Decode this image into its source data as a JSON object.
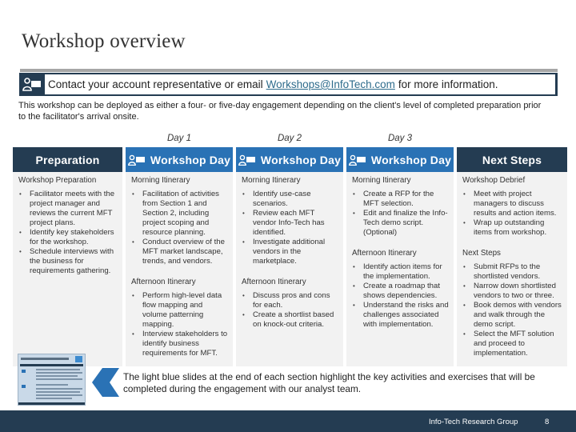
{
  "slide": {
    "title": "Workshop overview",
    "contact": {
      "prefix": "Contact your account representative or email",
      "email": "Workshops@InfoTech.com",
      "suffix": "for more information.",
      "icon": "person-board-icon"
    },
    "intro": "This workshop can be deployed as either a four- or five-day engagement depending on the client's level of completed preparation prior to the facilitator's arrival onsite.",
    "day_labels": [
      "Day 1",
      "Day 2",
      "Day 3"
    ],
    "columns": [
      {
        "header": "Preparation",
        "style": "dark",
        "sections": [
          {
            "title": "Workshop Preparation",
            "items": [
              "Facilitator meets with the project manager and reviews the current MFT project plans.",
              "Identify key stakeholders for the workshop.",
              "Schedule interviews with the business for requirements gathering."
            ]
          }
        ]
      },
      {
        "header": "Workshop Day",
        "style": "blue",
        "icon": "person-board-icon",
        "sections": [
          {
            "title": "Morning Itinerary",
            "items": [
              "Facilitation of activities from Section 1 and Section 2, including project scoping and resource planning.",
              "Conduct overview of the MFT market landscape, trends, and vendors."
            ]
          },
          {
            "title": "Afternoon Itinerary",
            "items": [
              "Perform high-level data flow mapping and volume patterning mapping.",
              "Interview stakeholders to identify business requirements for MFT."
            ]
          }
        ]
      },
      {
        "header": "Workshop Day",
        "style": "blue",
        "icon": "person-board-icon",
        "sections": [
          {
            "title": "Morning Itinerary",
            "items": [
              "Identify use-case scenarios.",
              "Review each MFT vendor Info-Tech has identified.",
              "Investigate additional vendors in the marketplace."
            ]
          },
          {
            "title": "Afternoon Itinerary",
            "items": [
              "Discuss pros and cons for each.",
              "Create a shortlist based on knock-out criteria."
            ]
          }
        ]
      },
      {
        "header": "Workshop Day",
        "style": "blue",
        "icon": "person-board-icon",
        "sections": [
          {
            "title": "Morning Itinerary",
            "items": [
              "Create a RFP for the MFT selection.",
              "Edit and finalize the Info-Tech demo script. (Optional)"
            ]
          },
          {
            "title": "Afternoon Itinerary",
            "items": [
              "Identify action items for the implementation.",
              "Create a roadmap that shows dependencies.",
              "Understand the risks and challenges associated with implementation."
            ]
          }
        ]
      },
      {
        "header": "Next Steps",
        "style": "dark",
        "sections": [
          {
            "title": "Workshop Debrief",
            "items": [
              "Meet with project managers to discuss results and action items.",
              "Wrap up outstanding items from workshop."
            ]
          },
          {
            "title": "Next Steps",
            "items": [
              "Submit RFPs to the shortlisted vendors.",
              "Narrow down shortlisted vendors to two or three.",
              "Book demos with vendors and walk through the demo script.",
              "Select the MFT solution and proceed to implementation."
            ]
          }
        ]
      }
    ],
    "note": "The light blue slides at the end of each section highlight the key activities and exercises that will be completed during the engagement with our analyst team.",
    "footer": {
      "org": "Info-Tech Research Group",
      "page": "8"
    },
    "colors": {
      "dark_navy": "#243c52",
      "accent_blue": "#2a72b5",
      "column_bg": "#f2f2f2",
      "rule_gray": "#a6a6a6",
      "link": "#2e6c8c"
    }
  }
}
